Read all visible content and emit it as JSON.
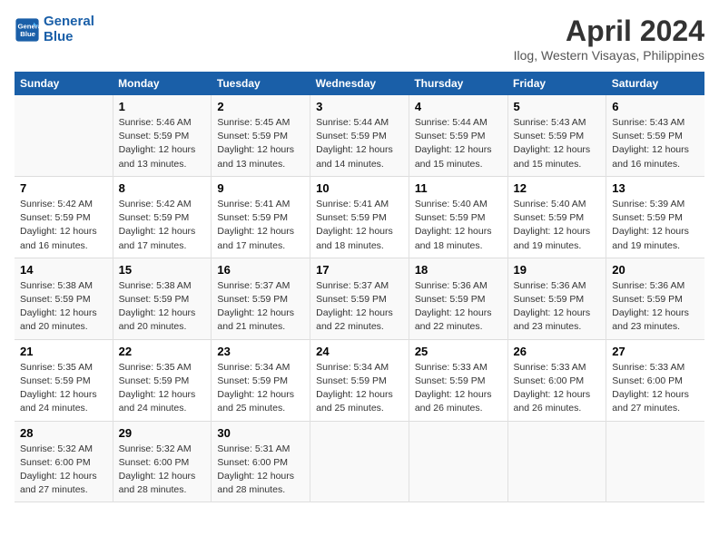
{
  "header": {
    "logo_line1": "General",
    "logo_line2": "Blue",
    "title": "April 2024",
    "subtitle": "Ilog, Western Visayas, Philippines"
  },
  "days_of_week": [
    "Sunday",
    "Monday",
    "Tuesday",
    "Wednesday",
    "Thursday",
    "Friday",
    "Saturday"
  ],
  "weeks": [
    [
      {
        "day": "",
        "text": ""
      },
      {
        "day": "1",
        "text": "Sunrise: 5:46 AM\nSunset: 5:59 PM\nDaylight: 12 hours\nand 13 minutes."
      },
      {
        "day": "2",
        "text": "Sunrise: 5:45 AM\nSunset: 5:59 PM\nDaylight: 12 hours\nand 13 minutes."
      },
      {
        "day": "3",
        "text": "Sunrise: 5:44 AM\nSunset: 5:59 PM\nDaylight: 12 hours\nand 14 minutes."
      },
      {
        "day": "4",
        "text": "Sunrise: 5:44 AM\nSunset: 5:59 PM\nDaylight: 12 hours\nand 15 minutes."
      },
      {
        "day": "5",
        "text": "Sunrise: 5:43 AM\nSunset: 5:59 PM\nDaylight: 12 hours\nand 15 minutes."
      },
      {
        "day": "6",
        "text": "Sunrise: 5:43 AM\nSunset: 5:59 PM\nDaylight: 12 hours\nand 16 minutes."
      }
    ],
    [
      {
        "day": "7",
        "text": "Sunrise: 5:42 AM\nSunset: 5:59 PM\nDaylight: 12 hours\nand 16 minutes."
      },
      {
        "day": "8",
        "text": "Sunrise: 5:42 AM\nSunset: 5:59 PM\nDaylight: 12 hours\nand 17 minutes."
      },
      {
        "day": "9",
        "text": "Sunrise: 5:41 AM\nSunset: 5:59 PM\nDaylight: 12 hours\nand 17 minutes."
      },
      {
        "day": "10",
        "text": "Sunrise: 5:41 AM\nSunset: 5:59 PM\nDaylight: 12 hours\nand 18 minutes."
      },
      {
        "day": "11",
        "text": "Sunrise: 5:40 AM\nSunset: 5:59 PM\nDaylight: 12 hours\nand 18 minutes."
      },
      {
        "day": "12",
        "text": "Sunrise: 5:40 AM\nSunset: 5:59 PM\nDaylight: 12 hours\nand 19 minutes."
      },
      {
        "day": "13",
        "text": "Sunrise: 5:39 AM\nSunset: 5:59 PM\nDaylight: 12 hours\nand 19 minutes."
      }
    ],
    [
      {
        "day": "14",
        "text": "Sunrise: 5:38 AM\nSunset: 5:59 PM\nDaylight: 12 hours\nand 20 minutes."
      },
      {
        "day": "15",
        "text": "Sunrise: 5:38 AM\nSunset: 5:59 PM\nDaylight: 12 hours\nand 20 minutes."
      },
      {
        "day": "16",
        "text": "Sunrise: 5:37 AM\nSunset: 5:59 PM\nDaylight: 12 hours\nand 21 minutes."
      },
      {
        "day": "17",
        "text": "Sunrise: 5:37 AM\nSunset: 5:59 PM\nDaylight: 12 hours\nand 22 minutes."
      },
      {
        "day": "18",
        "text": "Sunrise: 5:36 AM\nSunset: 5:59 PM\nDaylight: 12 hours\nand 22 minutes."
      },
      {
        "day": "19",
        "text": "Sunrise: 5:36 AM\nSunset: 5:59 PM\nDaylight: 12 hours\nand 23 minutes."
      },
      {
        "day": "20",
        "text": "Sunrise: 5:36 AM\nSunset: 5:59 PM\nDaylight: 12 hours\nand 23 minutes."
      }
    ],
    [
      {
        "day": "21",
        "text": "Sunrise: 5:35 AM\nSunset: 5:59 PM\nDaylight: 12 hours\nand 24 minutes."
      },
      {
        "day": "22",
        "text": "Sunrise: 5:35 AM\nSunset: 5:59 PM\nDaylight: 12 hours\nand 24 minutes."
      },
      {
        "day": "23",
        "text": "Sunrise: 5:34 AM\nSunset: 5:59 PM\nDaylight: 12 hours\nand 25 minutes."
      },
      {
        "day": "24",
        "text": "Sunrise: 5:34 AM\nSunset: 5:59 PM\nDaylight: 12 hours\nand 25 minutes."
      },
      {
        "day": "25",
        "text": "Sunrise: 5:33 AM\nSunset: 5:59 PM\nDaylight: 12 hours\nand 26 minutes."
      },
      {
        "day": "26",
        "text": "Sunrise: 5:33 AM\nSunset: 6:00 PM\nDaylight: 12 hours\nand 26 minutes."
      },
      {
        "day": "27",
        "text": "Sunrise: 5:33 AM\nSunset: 6:00 PM\nDaylight: 12 hours\nand 27 minutes."
      }
    ],
    [
      {
        "day": "28",
        "text": "Sunrise: 5:32 AM\nSunset: 6:00 PM\nDaylight: 12 hours\nand 27 minutes."
      },
      {
        "day": "29",
        "text": "Sunrise: 5:32 AM\nSunset: 6:00 PM\nDaylight: 12 hours\nand 28 minutes."
      },
      {
        "day": "30",
        "text": "Sunrise: 5:31 AM\nSunset: 6:00 PM\nDaylight: 12 hours\nand 28 minutes."
      },
      {
        "day": "",
        "text": ""
      },
      {
        "day": "",
        "text": ""
      },
      {
        "day": "",
        "text": ""
      },
      {
        "day": "",
        "text": ""
      }
    ]
  ]
}
